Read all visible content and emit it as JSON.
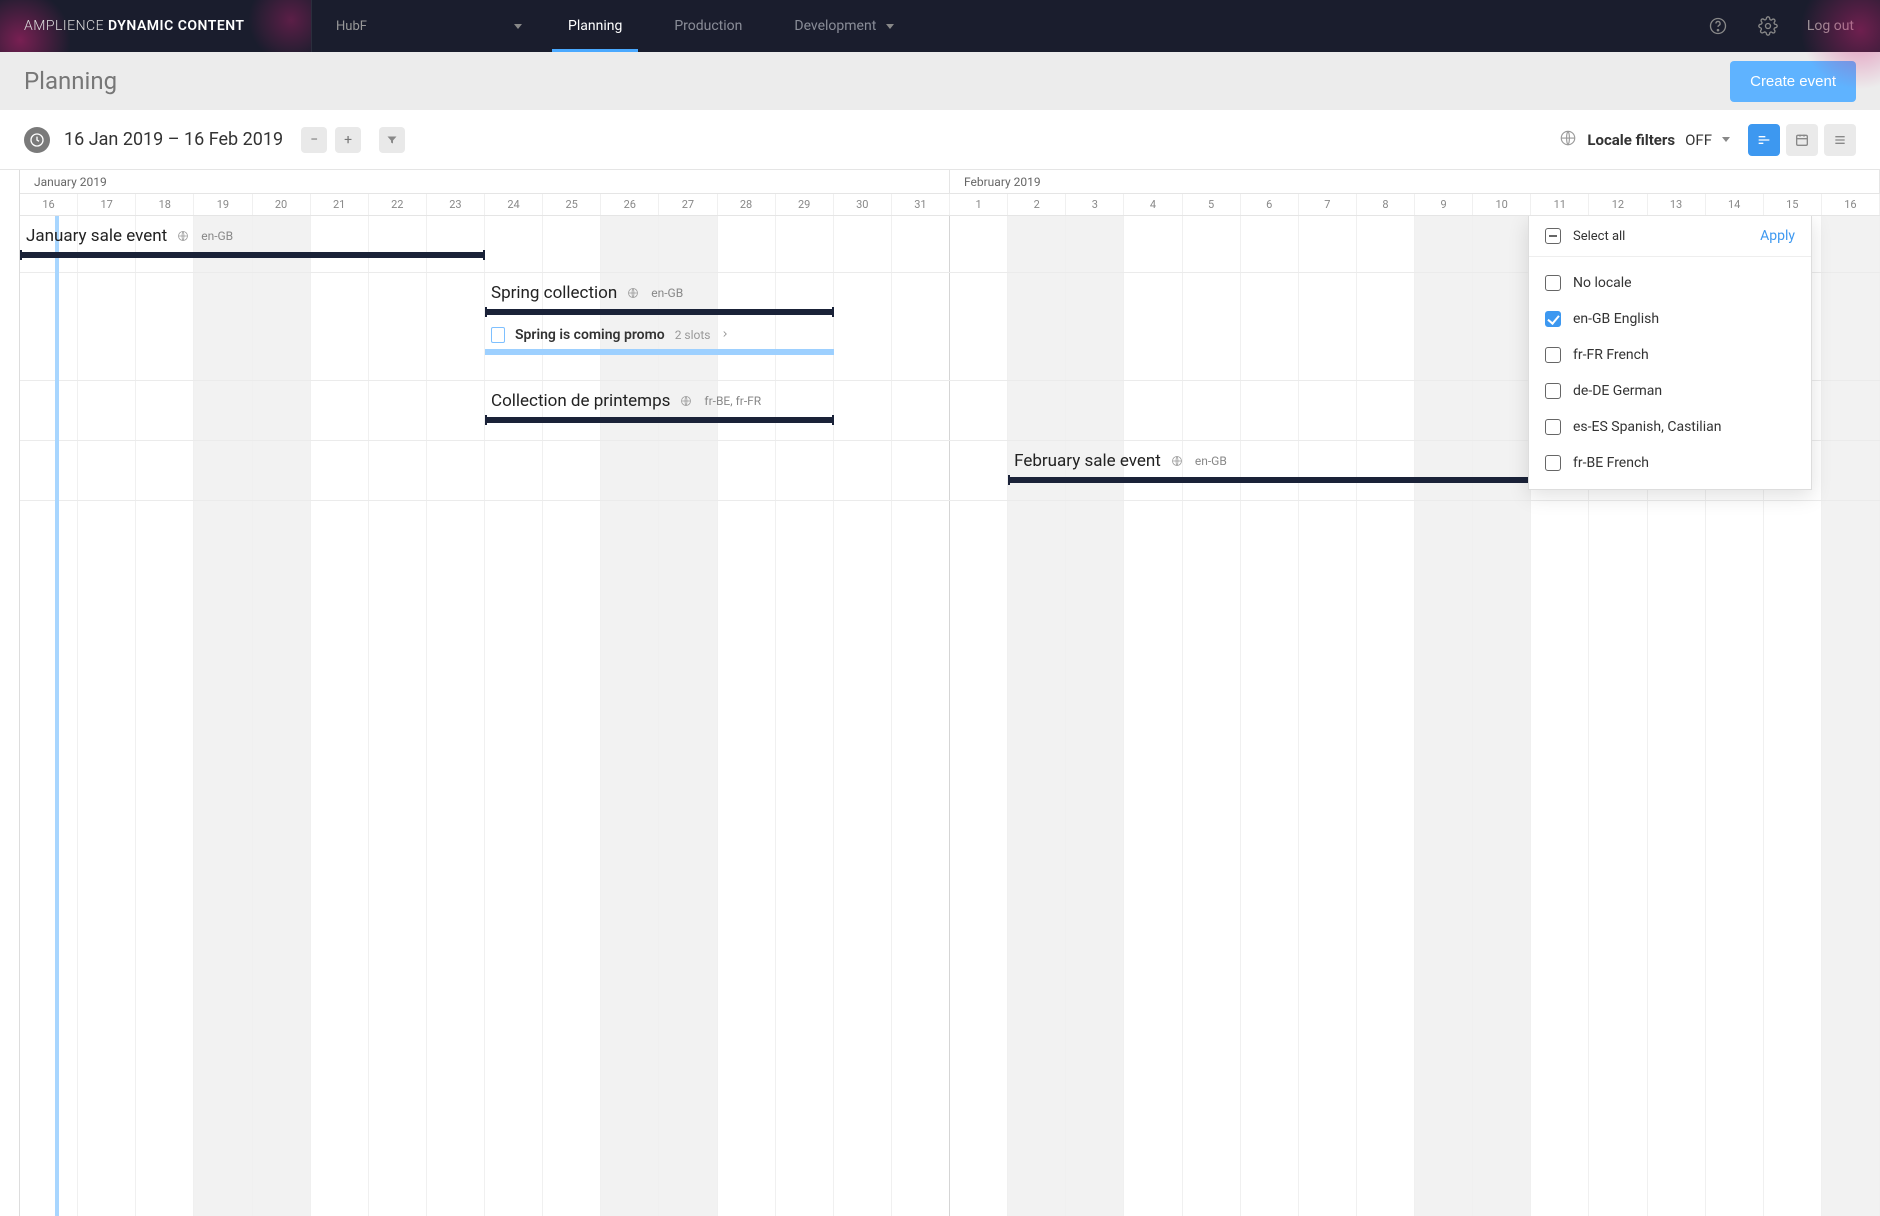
{
  "brand": {
    "light": "AMPLIENCE ",
    "bold": "DYNAMIC CONTENT"
  },
  "hub": {
    "name": "HubF"
  },
  "nav": {
    "tabs": [
      {
        "label": "Planning",
        "active": true,
        "chev": false
      },
      {
        "label": "Production",
        "active": false,
        "chev": false
      },
      {
        "label": "Development",
        "active": false,
        "chev": true
      }
    ],
    "logout": "Log out"
  },
  "page": {
    "title": "Planning",
    "create_button": "Create event"
  },
  "toolbar": {
    "date_range": "16 Jan 2019 – 16 Feb 2019",
    "locale_label": "Locale filters",
    "locale_value": "OFF"
  },
  "locale_popover": {
    "select_all": "Select all",
    "apply": "Apply",
    "options": [
      {
        "label": "No locale",
        "checked": false
      },
      {
        "label": "en-GB English",
        "checked": true
      },
      {
        "label": "fr-FR French",
        "checked": false
      },
      {
        "label": "de-DE German",
        "checked": false
      },
      {
        "label": "es-ES Spanish, Castilian",
        "checked": false
      },
      {
        "label": "fr-BE French",
        "checked": false
      }
    ]
  },
  "calendar": {
    "months": [
      {
        "label": "January 2019",
        "days": 16
      },
      {
        "label": "February 2019",
        "days": 16
      }
    ],
    "days": [
      16,
      17,
      18,
      19,
      20,
      21,
      22,
      23,
      24,
      25,
      26,
      27,
      28,
      29,
      30,
      31,
      1,
      2,
      3,
      4,
      5,
      6,
      7,
      8,
      9,
      10,
      11,
      12,
      13,
      14,
      15,
      16
    ]
  },
  "events": [
    {
      "title": "January sale event",
      "locale": "en-GB",
      "start": 0,
      "end": 8,
      "row": 0,
      "sub": null
    },
    {
      "title": "Spring collection",
      "locale": "en-GB",
      "start": 8,
      "end": 14,
      "row": 1,
      "sub": {
        "title": "Spring is coming promo",
        "slots": "2 slots",
        "start": 8,
        "end": 14
      }
    },
    {
      "title": "Collection de printemps",
      "locale": "fr-BE, fr-FR",
      "start": 8,
      "end": 14,
      "row": 2,
      "sub": null
    },
    {
      "title": "February sale event",
      "locale": "en-GB",
      "start": 17,
      "end": 28,
      "row": 3,
      "sub": null
    }
  ]
}
